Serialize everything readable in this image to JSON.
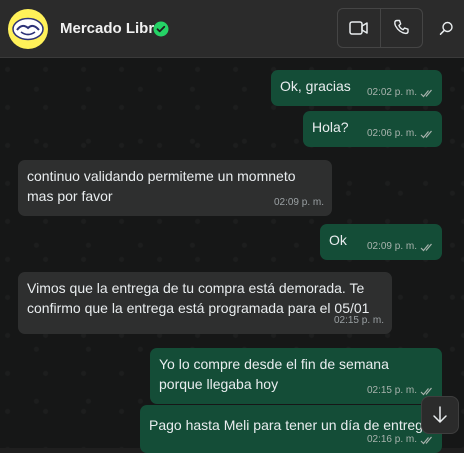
{
  "header": {
    "contact_name": "Mercado Libre"
  },
  "messages": [
    {
      "direction": "out",
      "text": "Ok, gracias",
      "time": "02:02 p. m."
    },
    {
      "direction": "out",
      "text": "Hola?",
      "time": "02:06 p. m."
    },
    {
      "direction": "in",
      "text": "continuo validando permiteme un momneto mas por favor",
      "time": "02:09 p. m."
    },
    {
      "direction": "out",
      "text": "Ok",
      "time": "02:09 p. m."
    },
    {
      "direction": "in",
      "text": "Vimos que la entrega de tu compra está demorada. Te confirmo que la entrega está programada para el 05/01",
      "time": "02:15 p. m."
    },
    {
      "direction": "out",
      "text": "Yo lo compre desde el fin de semana porque llegaba hoy",
      "time": "02:15 p. m."
    },
    {
      "direction": "out",
      "text": "Pago hasta Meli para tener un día de entrega",
      "time": "02:16 p. m."
    }
  ],
  "colors": {
    "outgoing_bubble": "#144d37",
    "incoming_bubble": "#2e2f2f",
    "verified": "#25d366",
    "read_ticks": "#a8b3ad"
  },
  "icons": [
    "mercado-libre-logo",
    "verified-badge-icon",
    "video-call-icon",
    "phone-icon",
    "search-icon",
    "double-check-icon",
    "arrow-down-icon"
  ]
}
